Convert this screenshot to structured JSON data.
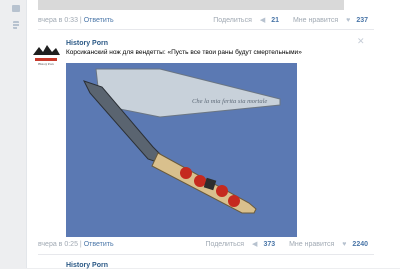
{
  "left_rail": {
    "icons": [
      "message-icon",
      "rss-icon"
    ]
  },
  "prev_post": {
    "time": "вчера в 0:33",
    "reply": "Ответить",
    "share_label": "Поделиться",
    "share_count": "21",
    "like_label": "Мне нравится",
    "like_count": "237"
  },
  "post": {
    "author": "History Porn",
    "avatar_caption": "History Porn",
    "text": "Корсиканский нож для вендетты: «Пусть все твои раны будут смертельными»",
    "blade_inscription": "Che la mia ferita sia mortale",
    "time": "вчера в 0:25",
    "reply": "Ответить",
    "share_label": "Поделиться",
    "share_count": "373",
    "like_label": "Мне нравится",
    "like_count": "2240"
  },
  "next_post": {
    "author": "History Porn"
  },
  "colors": {
    "link": "#4a76a8",
    "meta": "#a0a9b3",
    "photo_bg": "#5b79b3"
  }
}
